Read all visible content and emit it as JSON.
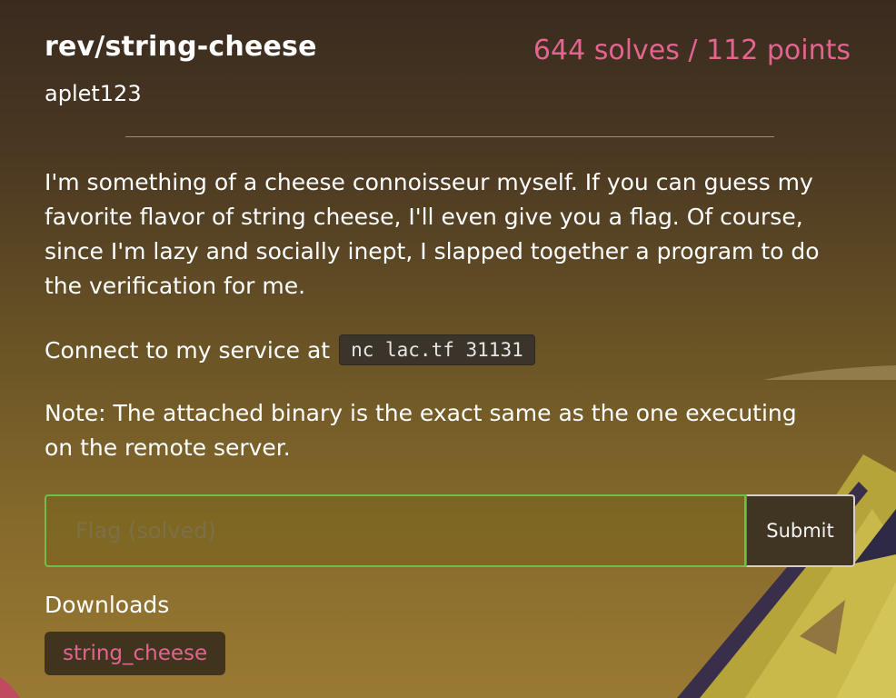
{
  "challenge": {
    "title": "rev/string-cheese",
    "author": "aplet123",
    "stats": "644 solves / 112 points",
    "description": "I'm something of a cheese connoisseur myself. If you can guess my favorite flavor of string cheese, I'll even give you a flag. Of course, since I'm lazy and socially inept, I slapped together a program to do the verification for me.",
    "connect_prefix": "Connect to my service at",
    "connect_command": "nc lac.tf 31131",
    "note": "Note: The attached binary is the exact same as the one executing on the remote server."
  },
  "flag_form": {
    "placeholder": "Flag (solved)",
    "value": "",
    "submit_label": "Submit"
  },
  "downloads": {
    "label": "Downloads",
    "files": [
      "string_cheese"
    ]
  },
  "colors": {
    "accent_pink": "#e2648f",
    "solved_border": "#6cc04a"
  }
}
